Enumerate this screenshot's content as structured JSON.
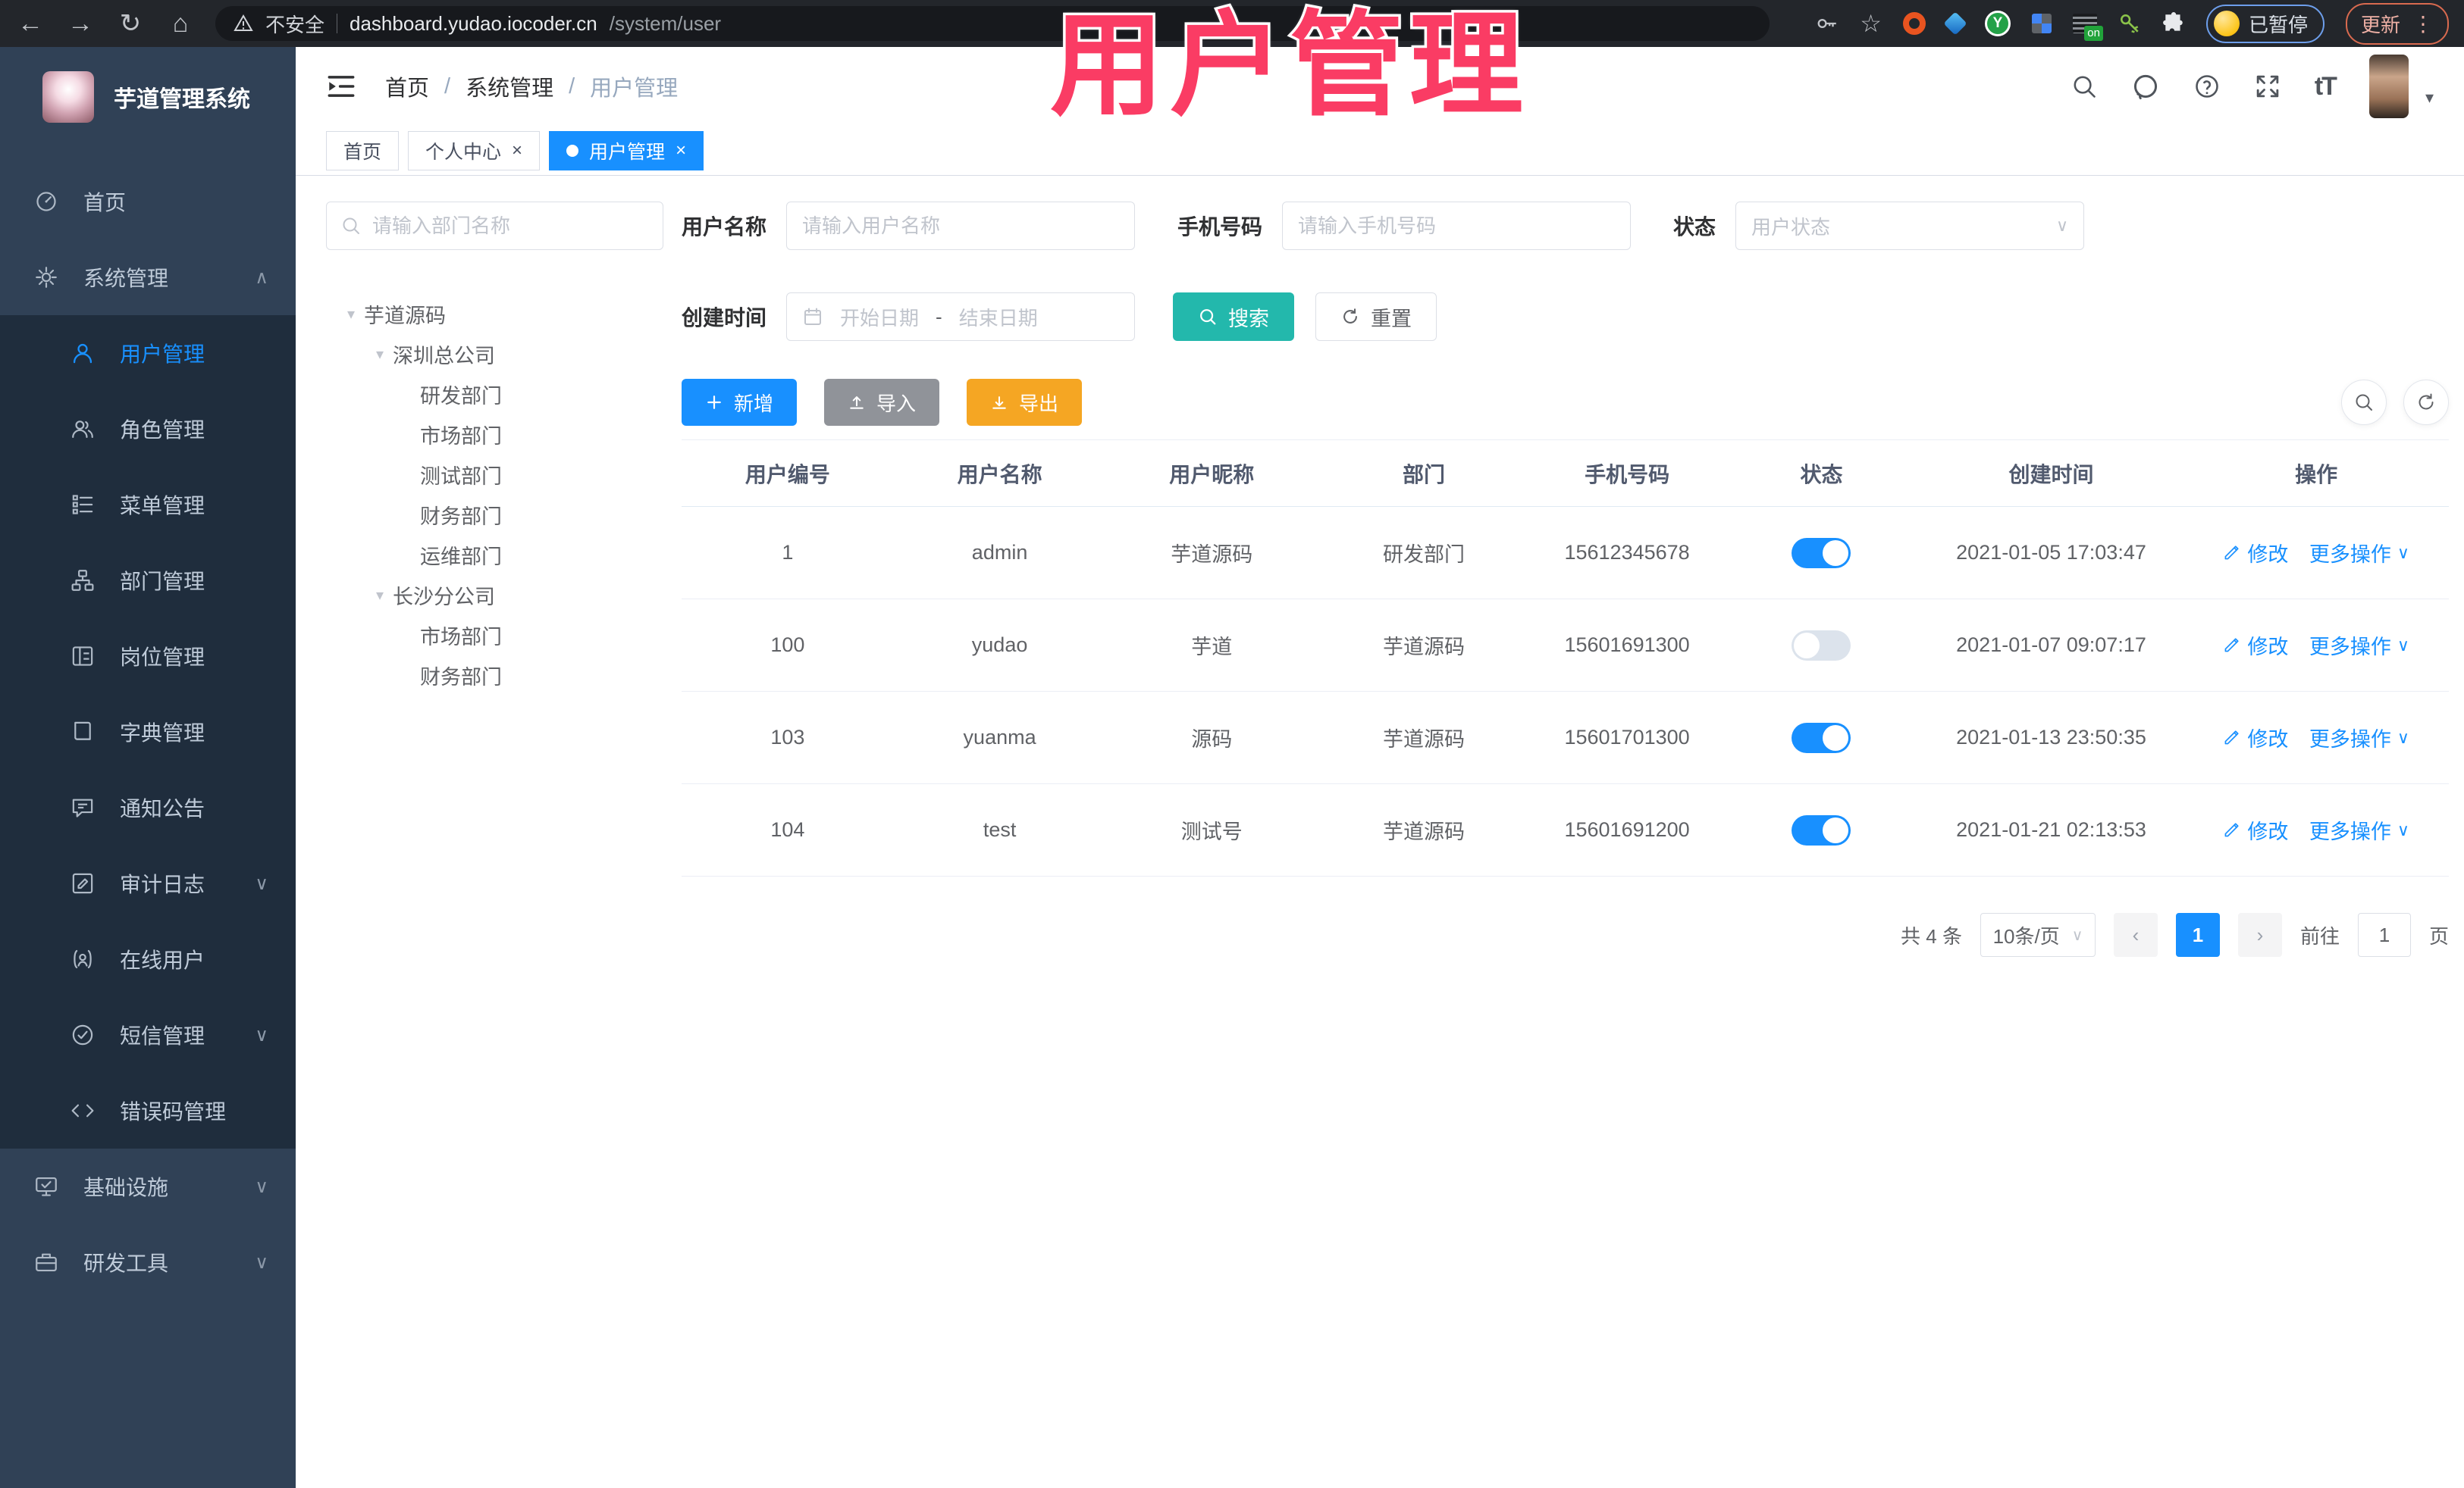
{
  "browser": {
    "security_label": "不安全",
    "url_host": "dashboard.yudao.iocoder.cn",
    "url_path": "/system/user",
    "paused_badge": "已暂停",
    "update_button": "更新"
  },
  "overlay_title": "用户管理",
  "ui": {
    "back_glyph": "←",
    "forward_glyph": "→",
    "reload_glyph": "↻",
    "home_glyph": "⌂",
    "star_glyph": "☆",
    "more_dots": "⋮",
    "close_glyph": "×",
    "chevron_down": "∨",
    "chevron_up": "∧",
    "tree_caret": "▾",
    "breadcrumb_separator": "/",
    "prev_glyph": "‹",
    "next_glyph": "›",
    "font_size_glyph": "tT",
    "avatar_caret": "▾",
    "y_badge": "Y",
    "on_badge": "on"
  },
  "sidebar": {
    "logo_title": "芋道管理系统",
    "items": [
      {
        "label": "首页"
      },
      {
        "label": "系统管理",
        "expanded": true
      },
      {
        "label": "用户管理",
        "active": true
      },
      {
        "label": "角色管理"
      },
      {
        "label": "菜单管理"
      },
      {
        "label": "部门管理"
      },
      {
        "label": "岗位管理"
      },
      {
        "label": "字典管理"
      },
      {
        "label": "通知公告"
      },
      {
        "label": "审计日志"
      },
      {
        "label": "在线用户"
      },
      {
        "label": "短信管理"
      },
      {
        "label": "错误码管理"
      },
      {
        "label": "基础设施"
      },
      {
        "label": "研发工具"
      }
    ]
  },
  "topbar": {
    "breadcrumb": [
      "首页",
      "系统管理",
      "用户管理"
    ]
  },
  "tabs": [
    {
      "label": "首页"
    },
    {
      "label": "个人中心",
      "closable": true
    },
    {
      "label": "用户管理",
      "active": true,
      "closable": true
    }
  ],
  "tree": {
    "search_placeholder": "请输入部门名称",
    "nodes": [
      {
        "label": "芋道源码",
        "depth": 0,
        "expandable": true
      },
      {
        "label": "深圳总公司",
        "depth": 1,
        "expandable": true
      },
      {
        "label": "研发部门",
        "depth": 2
      },
      {
        "label": "市场部门",
        "depth": 2
      },
      {
        "label": "测试部门",
        "depth": 2
      },
      {
        "label": "财务部门",
        "depth": 2
      },
      {
        "label": "运维部门",
        "depth": 2
      },
      {
        "label": "长沙分公司",
        "depth": 1,
        "expandable": true
      },
      {
        "label": "市场部门",
        "depth": 2
      },
      {
        "label": "财务部门",
        "depth": 2
      }
    ]
  },
  "filters": {
    "username_label": "用户名称",
    "username_placeholder": "请输入用户名称",
    "mobile_label": "手机号码",
    "mobile_placeholder": "请输入手机号码",
    "status_label": "状态",
    "status_placeholder": "用户状态",
    "date_label": "创建时间",
    "date_start_placeholder": "开始日期",
    "date_separator": "-",
    "date_end_placeholder": "结束日期",
    "search_button": "搜索",
    "reset_button": "重置"
  },
  "toolbar": {
    "add": "新增",
    "import": "导入",
    "export": "导出"
  },
  "table": {
    "headers": [
      "用户编号",
      "用户名称",
      "用户昵称",
      "部门",
      "手机号码",
      "状态",
      "创建时间",
      "操作"
    ],
    "action_edit": "修改",
    "action_more": "更多操作",
    "rows": [
      {
        "id": "1",
        "username": "admin",
        "nickname": "芋道源码",
        "dept": "研发部门",
        "mobile": "15612345678",
        "status": true,
        "created": "2021-01-05 17:03:47"
      },
      {
        "id": "100",
        "username": "yudao",
        "nickname": "芋道",
        "dept": "芋道源码",
        "mobile": "15601691300",
        "status": false,
        "created": "2021-01-07 09:07:17"
      },
      {
        "id": "103",
        "username": "yuanma",
        "nickname": "源码",
        "dept": "芋道源码",
        "mobile": "15601701300",
        "status": true,
        "created": "2021-01-13 23:50:35"
      },
      {
        "id": "104",
        "username": "test",
        "nickname": "测试号",
        "dept": "芋道源码",
        "mobile": "15601691200",
        "status": true,
        "created": "2021-01-21 02:13:53"
      }
    ]
  },
  "pagination": {
    "total": "共 4 条",
    "page_size": "10条/页",
    "current_page": "1",
    "goto_label": "前往",
    "goto_value": "1",
    "page_unit": "页"
  },
  "colors": {
    "primary": "#1890ff",
    "search_teal": "#23b8ac",
    "export_yellow": "#f5a623",
    "import_gray": "#909399",
    "sidebar_bg": "#304156",
    "submenu_bg": "#1f2d3d",
    "overlay_pink": "#fa3c64"
  }
}
